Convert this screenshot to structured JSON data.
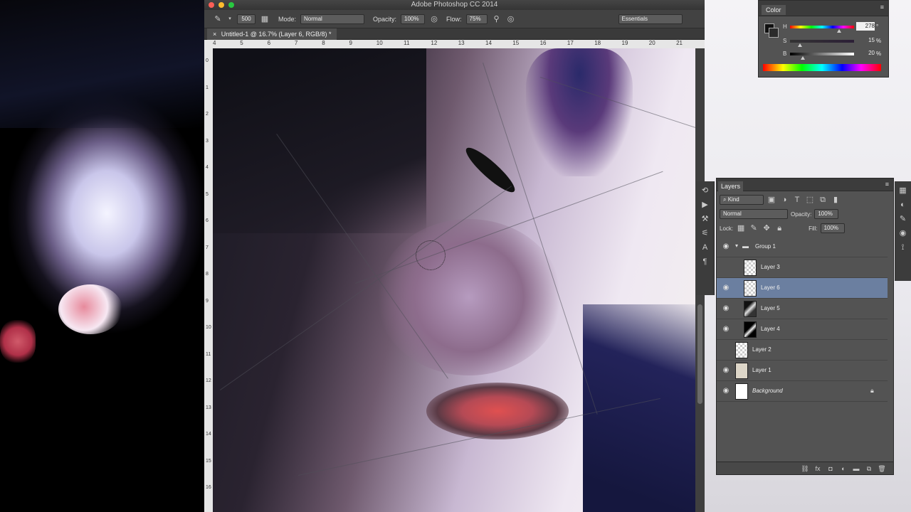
{
  "app": {
    "title": "Adobe Photoshop CC 2014",
    "traffic": {
      "close": "#fc5f57",
      "minimize": "#fdbc2e",
      "zoom": "#28c840"
    }
  },
  "options_bar": {
    "brush_size": "500",
    "mode_label": "Mode:",
    "mode_value": "Normal",
    "opacity_label": "Opacity:",
    "opacity_value": "100%",
    "flow_label": "Flow:",
    "flow_value": "75%",
    "workspace": "Essentials"
  },
  "document": {
    "tab_title": "Untitled-1 @ 16.7% (Layer 6, RGB/8) *",
    "ruler_top": [
      "4",
      "5",
      "6",
      "7",
      "8",
      "9",
      "10",
      "11",
      "12",
      "13",
      "14",
      "15",
      "16",
      "17",
      "18",
      "19",
      "20",
      "21"
    ],
    "ruler_left": [
      "0",
      "1",
      "2",
      "3",
      "4",
      "5",
      "6",
      "7",
      "8",
      "9",
      "10",
      "11",
      "12",
      "13",
      "14",
      "15",
      "16",
      "17"
    ]
  },
  "color_panel": {
    "title": "Color",
    "h_label": "H",
    "h_value": "278",
    "h_unit": "°",
    "s_label": "S",
    "s_value": "15",
    "s_unit": "%",
    "b_label": "B",
    "b_value": "20",
    "b_unit": "%",
    "h_level": 0.77,
    "s_level": 0.15,
    "b_level": 0.2
  },
  "layers_panel": {
    "title": "Layers",
    "filter_kind": "Kind",
    "blend_mode": "Normal",
    "opacity_label": "Opacity:",
    "opacity_value": "100%",
    "lock_label": "Lock:",
    "fill_label": "Fill:",
    "fill_value": "100%",
    "layers": [
      {
        "name": "Group 1",
        "visible": true
      },
      {
        "name": "Layer 3",
        "visible": false
      },
      {
        "name": "Layer 6",
        "visible": true,
        "selected": true
      },
      {
        "name": "Layer 5",
        "visible": true
      },
      {
        "name": "Layer 4",
        "visible": true
      },
      {
        "name": "Layer 2",
        "visible": false
      },
      {
        "name": "Layer 1",
        "visible": true
      },
      {
        "name": "Background",
        "visible": true,
        "locked": true
      }
    ]
  }
}
